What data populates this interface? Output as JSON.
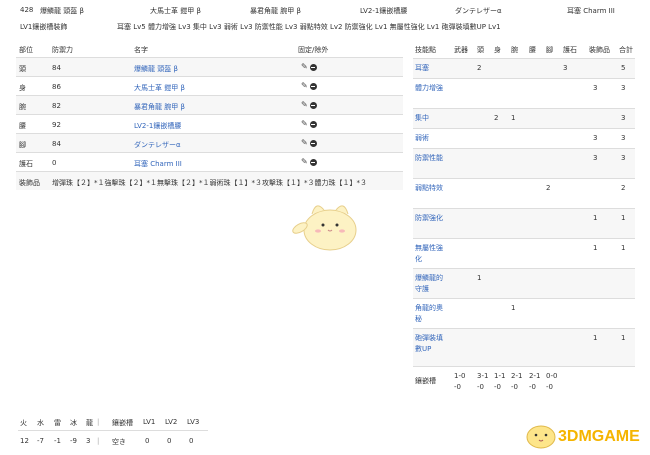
{
  "header": {
    "num": "428",
    "head": "爆鱗龍 頭盔 β",
    "chest": "大馬士革 鎧甲 β",
    "arms": "暴君角龍 腕甲 β",
    "waist": "LV2-1鑲嵌槽腰",
    "legs": "ダンテレザーα",
    "charm": "耳塞 Charm III",
    "charm_slot": "LV1鑲嵌槽裝飾",
    "skills": "耳塞 Lv5 體力增強 Lv3 集中 Lv3 弱術 Lv3 防禦性能 Lv3 弱點特效 Lv2 防禦強化 Lv1 無屬性強化 Lv1 砲彈裝填數UP Lv1"
  },
  "left_table": {
    "headers": {
      "part": "部位",
      "def": "防禦力",
      "name": "名字",
      "ctrl": "固定/除外"
    },
    "rows": [
      {
        "part": "頭",
        "def": "84",
        "name": "爆鱗龍 頭盔 β"
      },
      {
        "part": "身",
        "def": "86",
        "name": "大馬士革 鎧甲 β"
      },
      {
        "part": "腕",
        "def": "82",
        "name": "暴君角龍 腕甲 β"
      },
      {
        "part": "腰",
        "def": "92",
        "name": "LV2-1鑲嵌槽腰"
      },
      {
        "part": "腳",
        "def": "84",
        "name": "ダンテレザーα"
      },
      {
        "part": "護石",
        "def": "0",
        "name": "耳塞 Charm III"
      }
    ],
    "deco_label": "裝飾品",
    "deco_text": "增彈珠【２】*１強擊珠【２】*１無擊珠【２】*１弱術珠【１】*３攻擊珠【１】*３體力珠【１】*３"
  },
  "right_table": {
    "headers": [
      "技能點",
      "武器",
      "頭",
      "身",
      "腕",
      "腰",
      "腳",
      "護石",
      "裝飾品",
      "合計"
    ],
    "rows": [
      {
        "skill": "耳塞",
        "cells": [
          "",
          "2",
          "",
          "",
          "",
          "",
          "3",
          "",
          "5"
        ]
      },
      {
        "skill": "體力增強",
        "cells": [
          "",
          "",
          "",
          "",
          "",
          "",
          "",
          "3",
          "3"
        ]
      },
      {
        "skill": "集中",
        "cells": [
          "",
          "",
          "2",
          "1",
          "",
          "",
          "",
          "",
          "3"
        ]
      },
      {
        "skill": "弱術",
        "cells": [
          "",
          "",
          "",
          "",
          "",
          "",
          "",
          "3",
          "3"
        ]
      },
      {
        "skill": "防禦性能",
        "cells": [
          "",
          "",
          "",
          "",
          "",
          "",
          "",
          "3",
          "3"
        ]
      },
      {
        "skill": "弱點特效",
        "cells": [
          "",
          "",
          "",
          "",
          "",
          "2",
          "",
          "",
          "2"
        ]
      },
      {
        "skill": "防禦強化",
        "cells": [
          "",
          "",
          "",
          "",
          "",
          "",
          "",
          "1",
          "1"
        ]
      },
      {
        "skill": "無屬性強化",
        "cells": [
          "",
          "",
          "",
          "",
          "",
          "",
          "",
          "1",
          "1"
        ]
      },
      {
        "skill": "爆鱗龍的守護",
        "cells": [
          "",
          "1",
          "",
          "",
          "",
          "",
          "",
          "",
          ""
        ]
      },
      {
        "skill": "角龍的奧秘",
        "cells": [
          "",
          "",
          "",
          "1",
          "",
          "",
          "",
          "",
          ""
        ]
      },
      {
        "skill": "砲彈裝填數UP",
        "cells": [
          "",
          "",
          "",
          "",
          "",
          "",
          "",
          "1",
          "1"
        ]
      }
    ],
    "slots_label": "鑲嵌槽",
    "slots": [
      "1-0-0",
      "3-1-0",
      "1-1-0",
      "2-1-0",
      "2-1-0",
      "0-0-0"
    ]
  },
  "resist": {
    "headers": [
      "火",
      "水",
      "雷",
      "冰",
      "龍"
    ],
    "values": [
      "12",
      "-7",
      "-1",
      "-9",
      "3"
    ],
    "slot_headers": [
      "鑲嵌槽",
      "LV1",
      "LV2",
      "LV3"
    ],
    "slot_values": [
      "空き",
      "0",
      "0",
      "0"
    ]
  },
  "watermark": "3DMGAME"
}
